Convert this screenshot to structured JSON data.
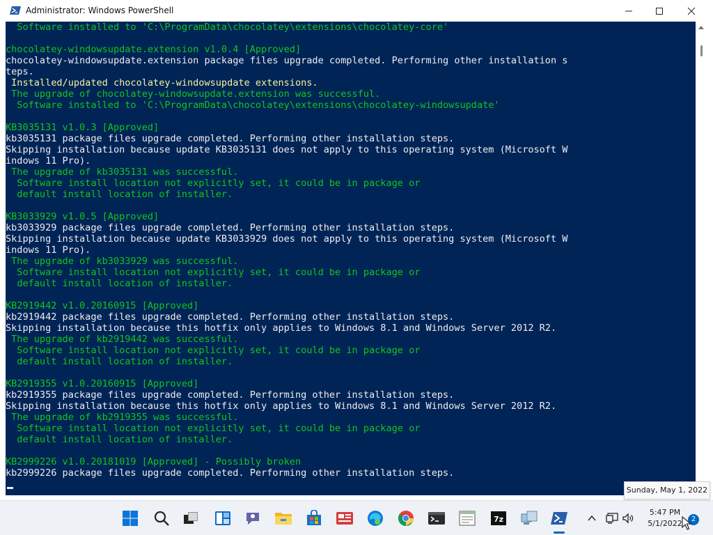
{
  "window": {
    "title": "Administrator: Windows PowerShell",
    "icon": "powershell-icon",
    "controls": [
      "minimize-icon",
      "maximize-icon",
      "close-icon"
    ]
  },
  "console": {
    "background": "#012456",
    "lines": [
      {
        "text": "  Software installed to 'C:\\ProgramData\\chocolatey\\extensions\\chocolatey-core'",
        "color": "green"
      },
      {
        "text": "",
        "color": "white"
      },
      {
        "text": "chocolatey-windowsupdate.extension v1.0.4 [Approved]",
        "color": "green"
      },
      {
        "text": "chocolatey-windowsupdate.extension package files upgrade completed. Performing other installation s",
        "color": "white"
      },
      {
        "text": "teps.",
        "color": "white"
      },
      {
        "text": " Installed/updated chocolatey-windowsupdate extensions.",
        "color": "yellow"
      },
      {
        "text": " The upgrade of chocolatey-windowsupdate.extension was successful.",
        "color": "green"
      },
      {
        "text": "  Software installed to 'C:\\ProgramData\\chocolatey\\extensions\\chocolatey-windowsupdate'",
        "color": "green"
      },
      {
        "text": "",
        "color": "white"
      },
      {
        "text": "KB3035131 v1.0.3 [Approved]",
        "color": "green"
      },
      {
        "text": "kb3035131 package files upgrade completed. Performing other installation steps.",
        "color": "white"
      },
      {
        "text": "Skipping installation because update KB3035131 does not apply to this operating system (Microsoft W",
        "color": "white"
      },
      {
        "text": "indows 11 Pro).",
        "color": "white"
      },
      {
        "text": " The upgrade of kb3035131 was successful.",
        "color": "green"
      },
      {
        "text": "  Software install location not explicitly set, it could be in package or",
        "color": "green"
      },
      {
        "text": "  default install location of installer.",
        "color": "green"
      },
      {
        "text": "",
        "color": "white"
      },
      {
        "text": "KB3033929 v1.0.5 [Approved]",
        "color": "green"
      },
      {
        "text": "kb3033929 package files upgrade completed. Performing other installation steps.",
        "color": "white"
      },
      {
        "text": "Skipping installation because update KB3033929 does not apply to this operating system (Microsoft W",
        "color": "white"
      },
      {
        "text": "indows 11 Pro).",
        "color": "white"
      },
      {
        "text": " The upgrade of kb3033929 was successful.",
        "color": "green"
      },
      {
        "text": "  Software install location not explicitly set, it could be in package or",
        "color": "green"
      },
      {
        "text": "  default install location of installer.",
        "color": "green"
      },
      {
        "text": "",
        "color": "white"
      },
      {
        "text": "KB2919442 v1.0.20160915 [Approved]",
        "color": "green"
      },
      {
        "text": "kb2919442 package files upgrade completed. Performing other installation steps.",
        "color": "white"
      },
      {
        "text": "Skipping installation because this hotfix only applies to Windows 8.1 and Windows Server 2012 R2.",
        "color": "white"
      },
      {
        "text": " The upgrade of kb2919442 was successful.",
        "color": "green"
      },
      {
        "text": "  Software install location not explicitly set, it could be in package or",
        "color": "green"
      },
      {
        "text": "  default install location of installer.",
        "color": "green"
      },
      {
        "text": "",
        "color": "white"
      },
      {
        "text": "KB2919355 v1.0.20160915 [Approved]",
        "color": "green"
      },
      {
        "text": "kb2919355 package files upgrade completed. Performing other installation steps.",
        "color": "white"
      },
      {
        "text": "Skipping installation because this hotfix only applies to Windows 8.1 and Windows Server 2012 R2.",
        "color": "white"
      },
      {
        "text": " The upgrade of kb2919355 was successful.",
        "color": "green"
      },
      {
        "text": "  Software install location not explicitly set, it could be in package or",
        "color": "green"
      },
      {
        "text": "  default install location of installer.",
        "color": "green"
      },
      {
        "text": "",
        "color": "white"
      },
      {
        "text": "KB2999226 v1.0.20181019 [Approved] - Possibly broken",
        "color": "green"
      },
      {
        "text": "kb2999226 package files upgrade completed. Performing other installation steps.",
        "color": "white"
      }
    ]
  },
  "taskbar": {
    "apps": [
      {
        "name": "start-icon"
      },
      {
        "name": "search-icon"
      },
      {
        "name": "task-view-icon"
      },
      {
        "name": "widgets-icon"
      },
      {
        "name": "chat-icon"
      },
      {
        "name": "file-explorer-icon"
      },
      {
        "name": "microsoft-store-icon"
      },
      {
        "name": "news-icon"
      },
      {
        "name": "edge-icon"
      },
      {
        "name": "chrome-icon"
      },
      {
        "name": "terminal-icon"
      },
      {
        "name": "notepad-icon"
      },
      {
        "name": "7zip-icon"
      },
      {
        "name": "network-app-icon"
      },
      {
        "name": "powershell-icon"
      }
    ],
    "tray": {
      "chevron": "chevron-up-icon",
      "network": "network-icon",
      "volume": "volume-icon",
      "time": "5:47 PM",
      "date": "5/1/2022",
      "notifications": "2"
    },
    "tooltip": "Sunday, May 1, 2022"
  }
}
